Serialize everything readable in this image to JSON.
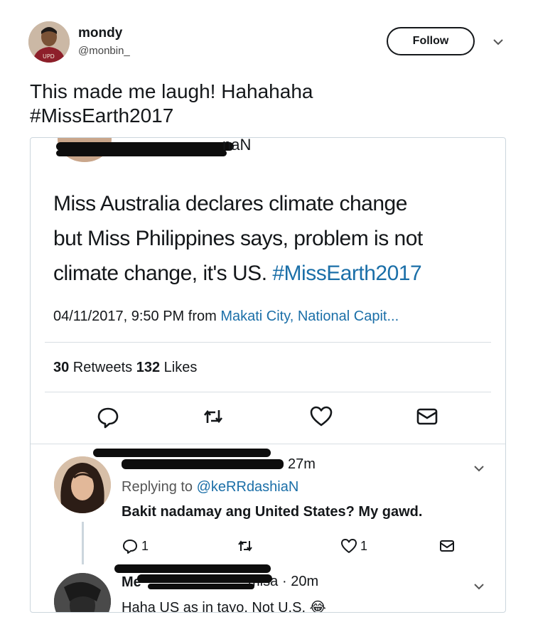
{
  "author": {
    "name": "mondy",
    "handle": "@monbin_"
  },
  "follow_label": "Follow",
  "tweet": {
    "line1": "This made me laugh! Hahahaha",
    "line2": "#MissEarth2017"
  },
  "embedded": {
    "header_partial": "naN",
    "text_line1": "Miss Australia declares climate change",
    "text_line2": "but Miss Philippines says, problem is not",
    "text_line3_plain": "climate change, it's US. ",
    "text_line3_tag": "#MissEarth2017",
    "timestamp": "04/11/2017, 9:50 PM from ",
    "location": "Makati City, National Capit...",
    "retweets_count": "30",
    "retweets_label": " Retweets ",
    "likes_count": "132",
    "likes_label": " Likes",
    "reply1": {
      "time": "27m",
      "replying_prefix": "Replying to ",
      "replying_handle": "@keRRdashiaN",
      "text": "Bakit nadamay ang United States? My gawd.",
      "reply_count": "1",
      "like_count": "1"
    },
    "reply2": {
      "name_start": "Me",
      "name_end": "misa",
      "time": "· 20m",
      "text": "Haha US as in tayo. Not U.S. 😂"
    }
  },
  "colors": {
    "link": "#1b6fa8",
    "text": "#14171a",
    "border": "#ccd6dd"
  },
  "icons": [
    "chevron-down-icon",
    "reply-icon",
    "retweet-icon",
    "like-icon",
    "message-icon"
  ]
}
